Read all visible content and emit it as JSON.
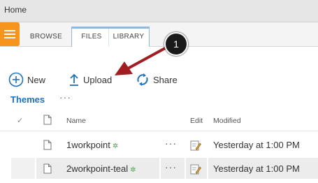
{
  "topbar": {
    "title": "Home"
  },
  "ribbon": {
    "tabs": [
      {
        "label": "BROWSE"
      },
      {
        "label": "FILES"
      },
      {
        "label": "LIBRARY"
      }
    ]
  },
  "commands": {
    "new_label": "New",
    "upload_label": "Upload",
    "share_label": "Share"
  },
  "library": {
    "title": "Themes",
    "more": "···",
    "columns": {
      "name": "Name",
      "edit": "Edit",
      "modified": "Modified"
    },
    "rows": [
      {
        "name": "1workpoint",
        "new_marker": "✲",
        "more": "···",
        "modified": "Yesterday at 1:00 PM"
      },
      {
        "name": "2workpoint-teal",
        "new_marker": "✲",
        "more": "···",
        "modified": "Yesterday at 1:00 PM"
      }
    ]
  },
  "callout": {
    "number": "1"
  },
  "colors": {
    "accent": "#1b72c5",
    "menu": "#f7941e",
    "arrow": "#a11d22",
    "tab_border": "#8fb9e5"
  }
}
